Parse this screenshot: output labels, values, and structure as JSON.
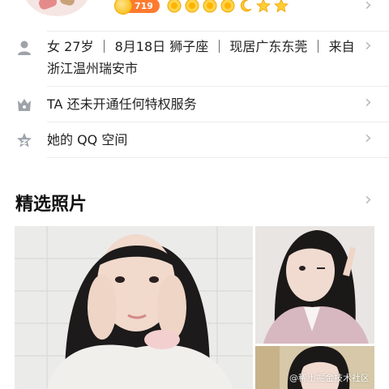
{
  "header": {
    "level_number": "719",
    "level_icons": [
      "sun-icon",
      "sun-icon",
      "sun-icon",
      "sun-icon",
      "moon-icon",
      "star-icon",
      "star-icon"
    ]
  },
  "profile": {
    "info_line1": "女 27岁 ｜ 8月18日 狮子座 ｜ 现居广东东莞 ｜ 来自",
    "info_line2": "浙江温州瑞安市",
    "privilege": "TA 还未开通任何特权服务",
    "qzone": "她的 QQ 空间"
  },
  "photos": {
    "title": "精选照片",
    "watermark": "@稀土掘金技术社区"
  },
  "colors": {
    "accent_orange": "#ff7a2f",
    "gold": "#f7b500",
    "icon_gray": "#9ea3aa",
    "chevron": "#b8b8b8"
  }
}
